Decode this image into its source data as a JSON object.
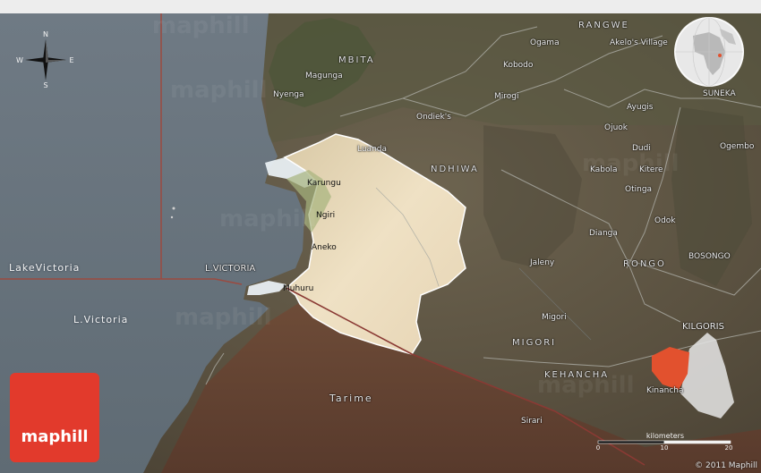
{
  "map": {
    "labels": {
      "rangwe": "RANGWE",
      "mbita": "MBITA",
      "ndhiwa": "NDHIWA",
      "rongo": "RONGO",
      "migori_region": "MIGORI",
      "kehancha": "KEHANCHA",
      "kilgoris": "KILGORIS",
      "suneka": "SUNEKA",
      "bosongo": "BOSONGO",
      "ogama": "Ogama",
      "akelos_village": "Akelo's Village",
      "kobodo": "Kobodo",
      "magunga": "Magunga",
      "mirogi": "Mirogi",
      "nyenga": "Nyenga",
      "ondieks": "Ondiek's",
      "ayugis": "Ayugis",
      "ojuok": "Ojuok",
      "ogembo": "Ogembo",
      "luanda": "Luanda",
      "dudi": "Dudi",
      "kabola": "Kabola",
      "kitere": "Kitere",
      "karungu": "Karungu",
      "otinga": "Otinga",
      "ngiri": "Ngiri",
      "odok": "Odok",
      "dianga": "Dianga",
      "aneko": "Aneko",
      "jaleny": "Jaleny",
      "lake_victoria_left": "LakeVictoria",
      "l_victoria_pt": "L.VICTORIA",
      "muhuru": "Muhuru",
      "migori_town": "Migori",
      "l_victoria_water": "L.Victoria",
      "kinancha": "Kinancha",
      "tarime": "Tarime",
      "sirari": "Sirari"
    },
    "compass": {
      "n": "N",
      "s": "S",
      "e": "E",
      "w": "W"
    },
    "scale": {
      "title": "kilometers",
      "ticks": [
        "0",
        "10",
        "20"
      ]
    },
    "logo_text": "maphill",
    "watermark": "maphill",
    "copyright": "© 2011 Maphill",
    "colors": {
      "water": "#6a7680",
      "highlight": "#f3e4c8",
      "logo": "#e23a2c",
      "inset_region": "#e2512e"
    }
  }
}
